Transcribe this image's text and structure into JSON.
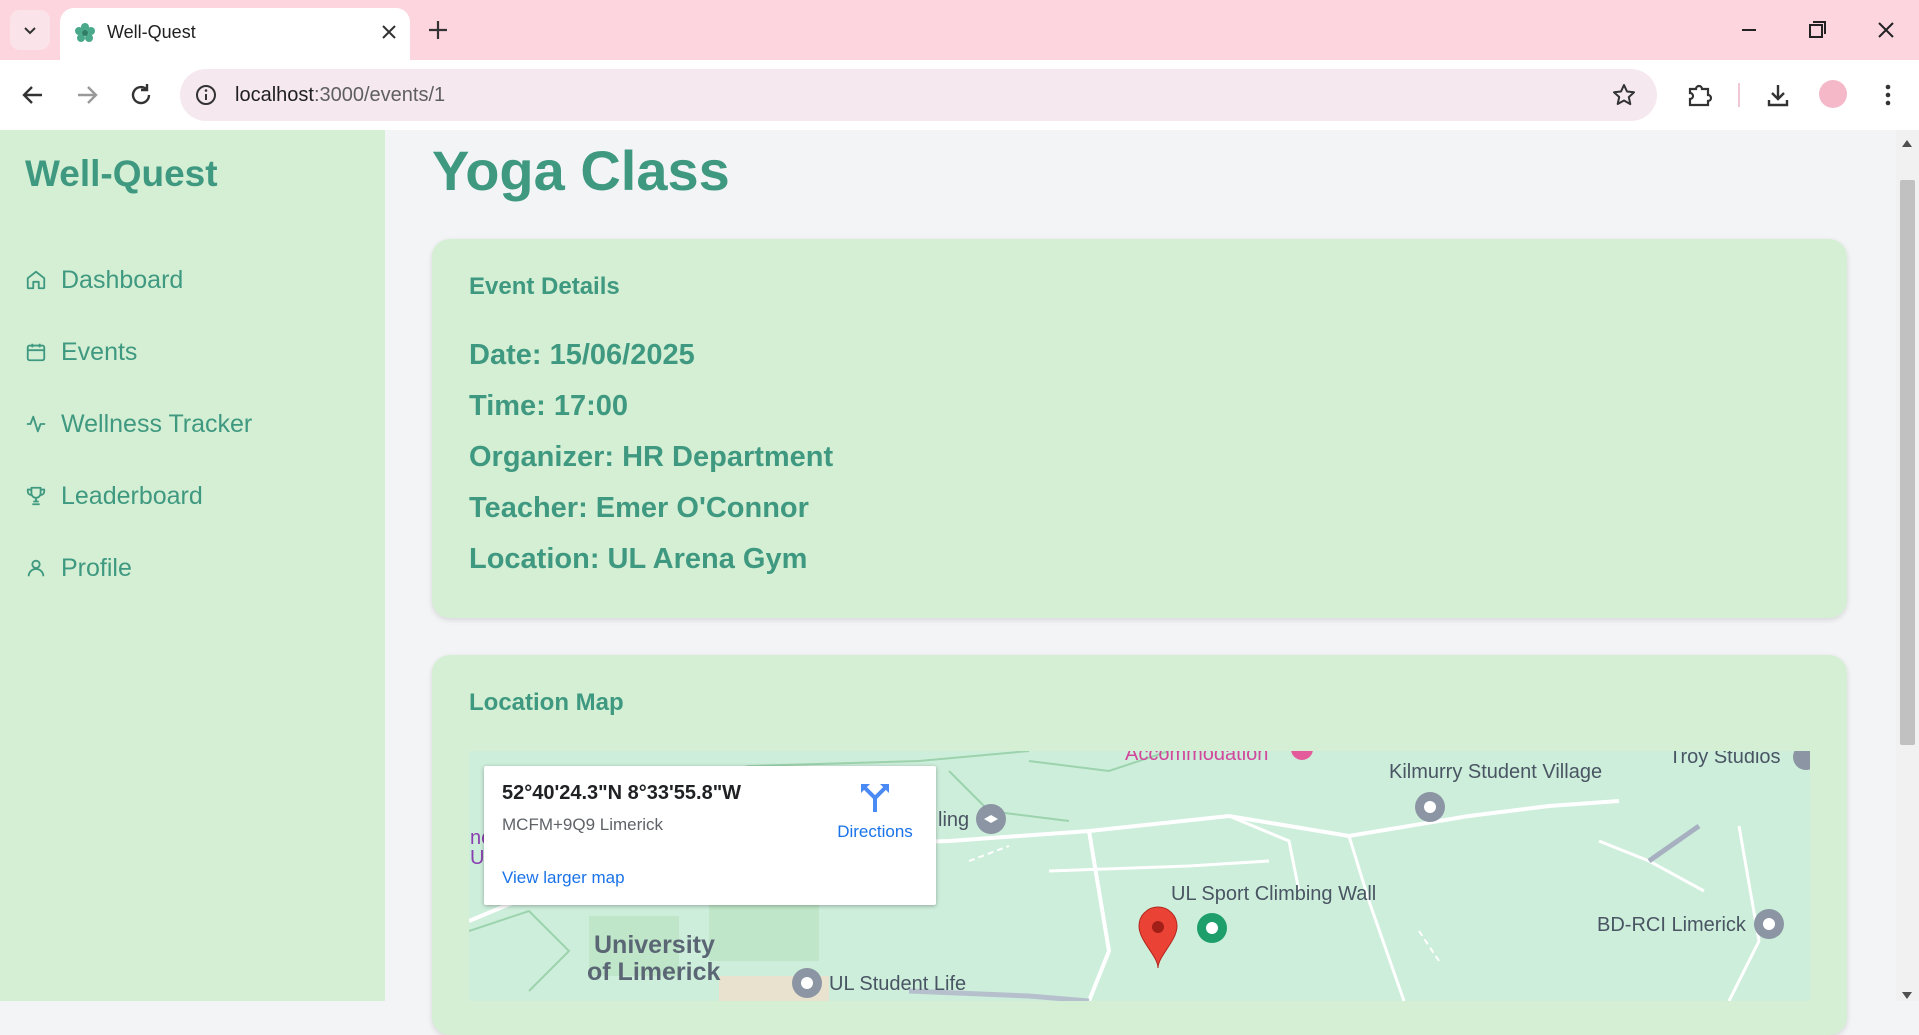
{
  "browser": {
    "tab_title": "Well-Quest",
    "url_host": "localhost",
    "url_path": ":3000/events/1"
  },
  "sidebar": {
    "brand": "Well-Quest",
    "items": [
      {
        "label": "Dashboard",
        "icon": "home-icon"
      },
      {
        "label": "Events",
        "icon": "calendar-icon"
      },
      {
        "label": "Wellness Tracker",
        "icon": "activity-icon"
      },
      {
        "label": "Leaderboard",
        "icon": "trophy-icon"
      },
      {
        "label": "Profile",
        "icon": "user-icon"
      }
    ]
  },
  "main": {
    "title": "Yoga Class",
    "details_card": {
      "heading": "Event Details",
      "date": "Date: 15/06/2025",
      "time": "Time: 17:00",
      "organizer": "Organizer: HR Department",
      "teacher": "Teacher: Emer O'Connor",
      "location": "Location: UL Arena Gym"
    },
    "map_card": {
      "heading": "Location Map",
      "coords": "52°40'24.3\"N 8°33'55.8\"W",
      "plus_code": "MCFM+9Q9 Limerick",
      "directions_label": "Directions",
      "larger_map_label": "View larger map",
      "labels": {
        "accommodation": "Accommodation",
        "kilmurry": "Kilmurry Student Village",
        "troy": "Troy Studios",
        "building_fragment": "ling",
        "climbing": "UL Sport Climbing Wall",
        "bd_rci": "BD-RCI Limerick",
        "university_1": "University",
        "university_2": "of Limerick",
        "student_life": "UL Student Life",
        "left_fragment_1": "ne",
        "left_fragment_2": "U"
      }
    }
  },
  "colors": {
    "accent": "#3f9980",
    "sidebar_bg": "#d5efd4",
    "tabbar_bg": "#fdd5df"
  }
}
